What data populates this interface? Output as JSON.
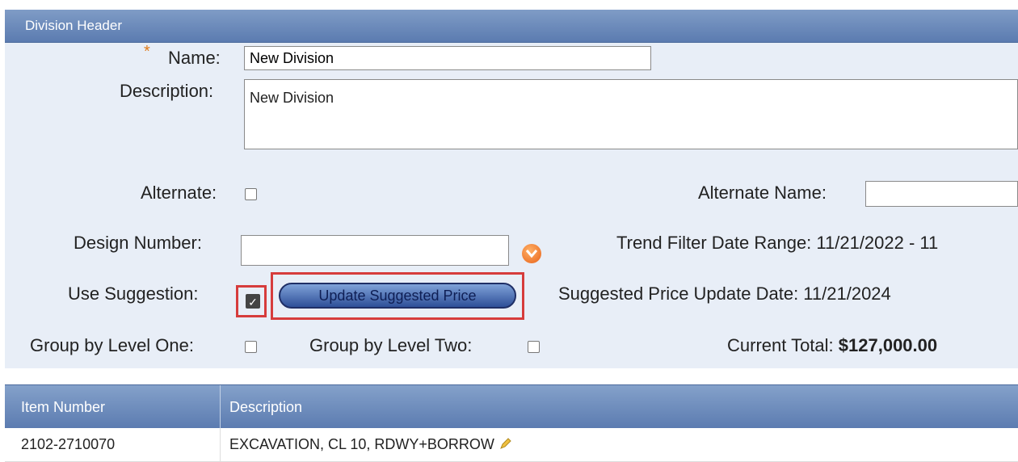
{
  "panel": {
    "title": "Division Header"
  },
  "form": {
    "name_label": "Name:",
    "name_value": "New Division",
    "description_label": "Description:",
    "description_value": "New Division",
    "alternate_label": "Alternate:",
    "alternate_name_label": "Alternate Name:",
    "design_number_label": "Design Number:",
    "trend_filter_label": "Trend Filter Date Range: 11/21/2022 - 11",
    "use_suggestion_label": "Use Suggestion:",
    "update_price_button": "Update Suggested Price",
    "suggested_price_date_label": "Suggested Price Update Date: 11/21/2024",
    "group_level_one_label": "Group by Level One:",
    "group_level_two_label": "Group by Level Two:",
    "current_total_label": "Current Total:",
    "current_total_value": "$127,000.00"
  },
  "grid": {
    "columns": [
      "Item Number",
      "Description"
    ],
    "rows": [
      {
        "item_number": "2102-2710070",
        "description": "EXCAVATION, CL 10, RDWY+BORROW"
      }
    ]
  },
  "colors": {
    "header_blue": "#5b7bb0",
    "form_bg": "#e8eef7",
    "highlight_red": "#d63c3c",
    "required_orange": "#e07b1a"
  }
}
